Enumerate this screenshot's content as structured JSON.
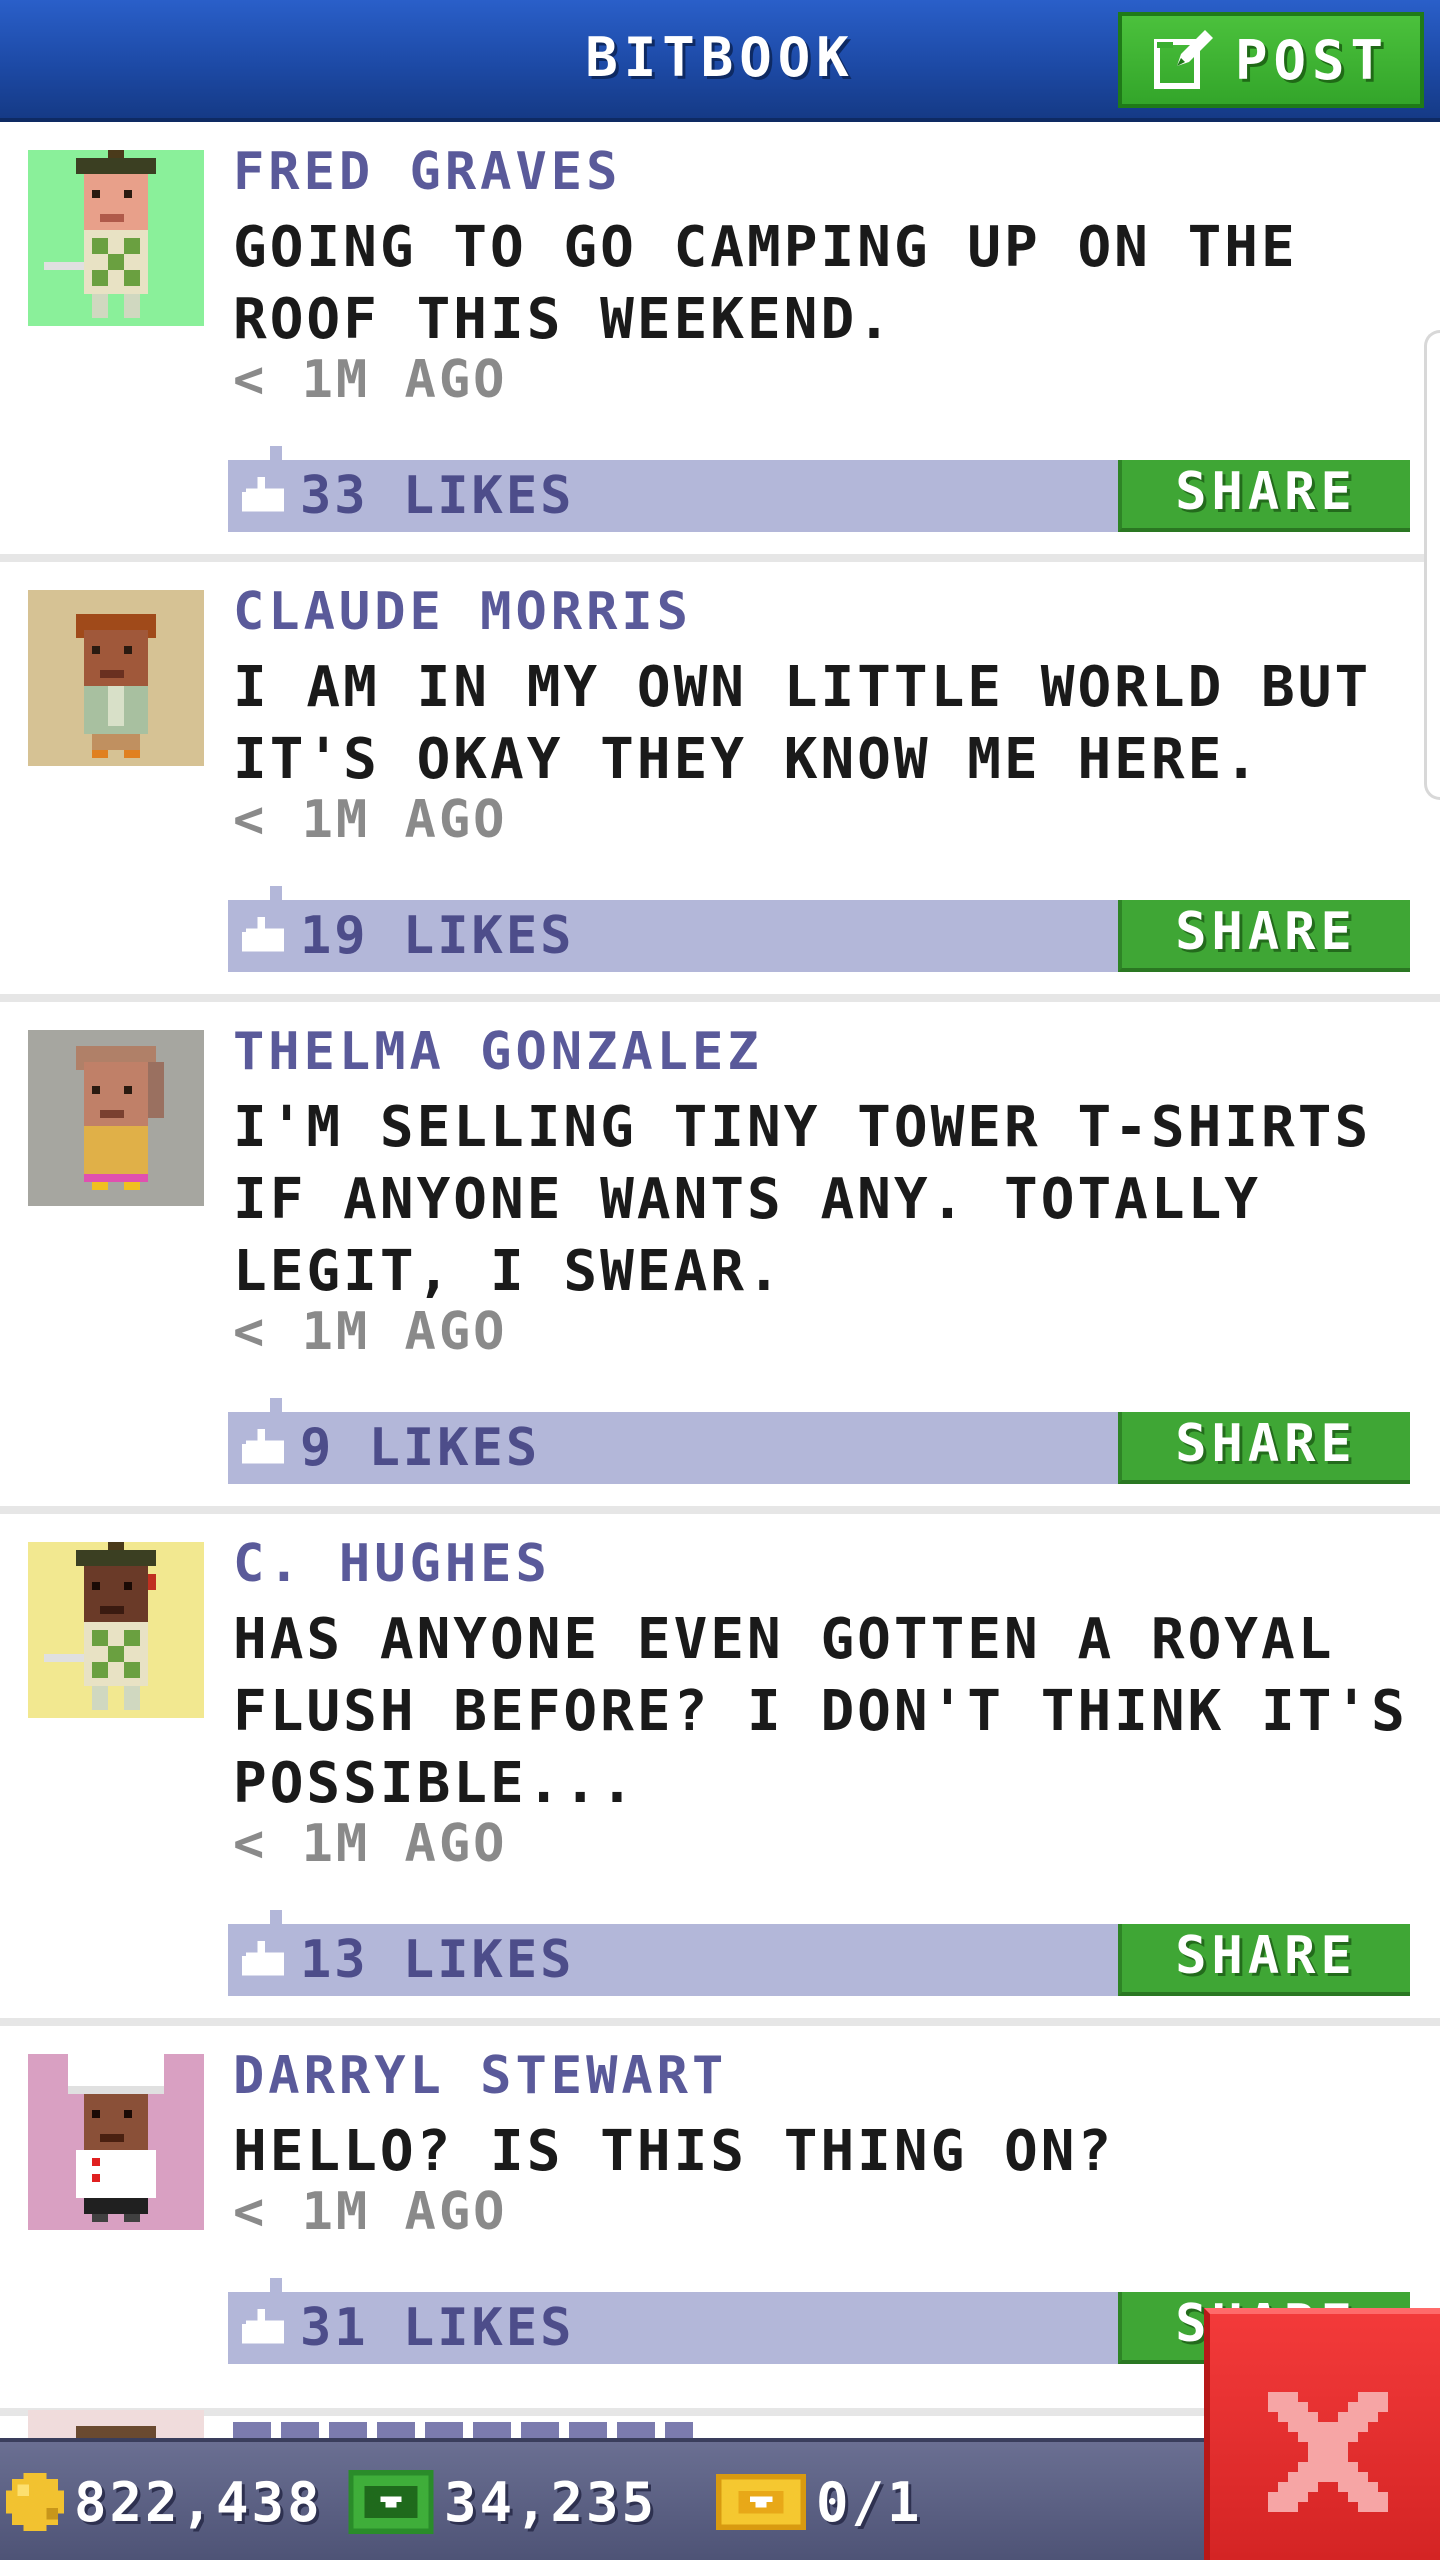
{
  "header": {
    "title": "BITBOOK",
    "post_label": "POST"
  },
  "posts": [
    {
      "author": "FRED GRAVES",
      "text": "GOING TO GO CAMPING UP ON THE ROOF THIS WEEKEND.",
      "time": "< 1M AGO",
      "likes": "33 LIKES",
      "share_label": "SHARE",
      "avatar_bg": "#8af09a"
    },
    {
      "author": "CLAUDE MORRIS",
      "text": "I AM IN MY OWN LITTLE WORLD BUT IT'S OKAY THEY KNOW ME HERE.",
      "time": "< 1M AGO",
      "likes": "19 LIKES",
      "share_label": "SHARE",
      "avatar_bg": "#d6c294"
    },
    {
      "author": "THELMA GONZALEZ",
      "text": "I'M SELLING TINY TOWER T-SHIRTS IF ANYONE WANTS ANY. TOTALLY LEGIT, I SWEAR.",
      "time": "< 1M AGO",
      "likes": "9 LIKES",
      "share_label": "SHARE",
      "avatar_bg": "#a6a6a0"
    },
    {
      "author": "C. HUGHES",
      "text": "HAS ANYONE EVEN GOTTEN A ROYAL FLUSH BEFORE? I DON'T THINK IT'S POSSIBLE...",
      "time": "< 1M AGO",
      "likes": "13 LIKES",
      "share_label": "SHARE",
      "avatar_bg": "#f2e890"
    },
    {
      "author": "DARRYL STEWART",
      "text": "HELLO? IS THIS THING ON?",
      "time": "< 1M AGO",
      "likes": "31 LIKES",
      "share_label": "SHARE",
      "avatar_bg": "#d9a0c2"
    }
  ],
  "status": {
    "coins": "822,438",
    "bux": "34,235",
    "tickets": "0/1"
  },
  "colors": {
    "header_blue": "#1d4aa6",
    "post_green": "#3fa635",
    "likes_bar": "#b3b7d9",
    "author_purple": "#5a5a9a",
    "close_red": "#e02e2e"
  },
  "icons": {
    "post": "edit-icon",
    "like": "thumbs-up-icon",
    "coin": "coin-icon",
    "bux": "bux-icon",
    "ticket": "golden-ticket-icon",
    "close": "close-icon"
  }
}
